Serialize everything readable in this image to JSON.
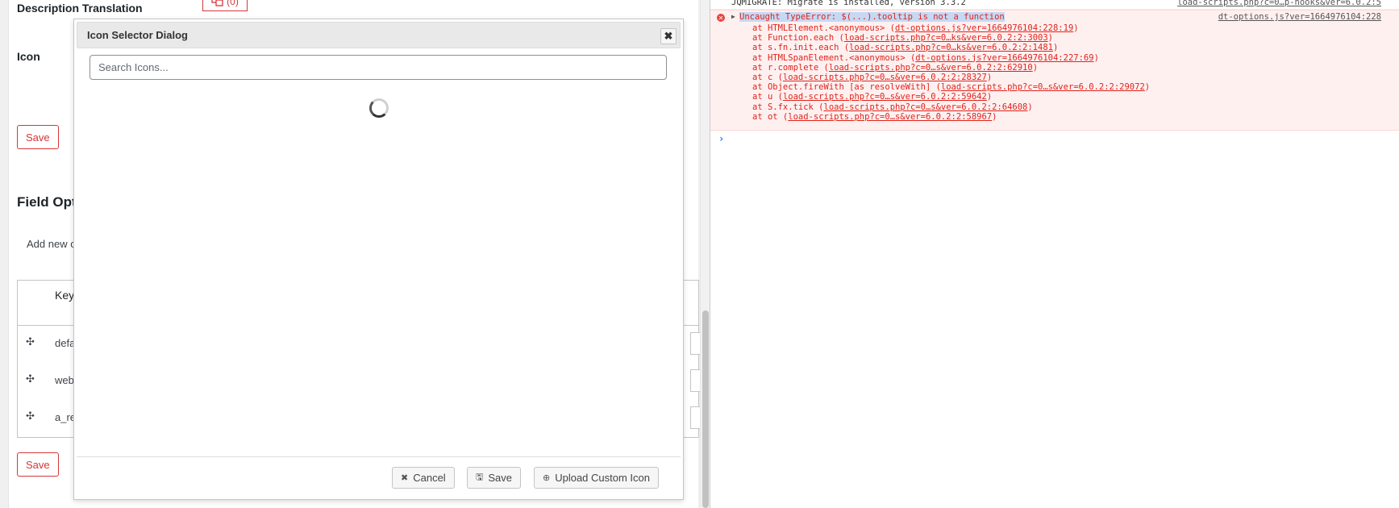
{
  "left_page": {
    "description_translation_label": "Description Translation",
    "translation_count": "(0)",
    "icon_label": "Icon",
    "save_top": "Save",
    "field_options_title": "Field Opt",
    "add_new_text": "Add new o",
    "table": {
      "header_key": "Key",
      "rows": [
        "defa",
        "web",
        "a_re"
      ]
    },
    "save_bottom": "Save"
  },
  "dialog": {
    "title": "Icon Selector Dialog",
    "close_glyph": "✖",
    "search_placeholder": "Search Icons...",
    "buttons": {
      "cancel": "Cancel",
      "save": "Save",
      "upload": "Upload Custom Icon"
    }
  },
  "console": {
    "info_line": "JQMIGRATE: Migrate is installed, version 3.3.2",
    "info_source": "load-scripts.php?c=0…p-hooks&ver=6.0.2:5",
    "error": {
      "title": "Uncaught TypeError: $(...).tooltip is not a function",
      "source": "dt-options.js?ver=1664976104:228",
      "stack": [
        {
          "fn": "at HTMLElement.<anonymous> (",
          "link": "dt-options.js?ver=1664976104:228:19",
          "end": ")"
        },
        {
          "fn": "at Function.each (",
          "link": "load-scripts.php?c=0…ks&ver=6.0.2:2:3003",
          "end": ")"
        },
        {
          "fn": "at s.fn.init.each (",
          "link": "load-scripts.php?c=0…ks&ver=6.0.2:2:1481",
          "end": ")"
        },
        {
          "fn": "at HTMLSpanElement.<anonymous> (",
          "link": "dt-options.js?ver=1664976104:227:69",
          "end": ")"
        },
        {
          "fn": "at r.complete (",
          "link": "load-scripts.php?c=0…s&ver=6.0.2:2:62910",
          "end": ")"
        },
        {
          "fn": "at c (",
          "link": "load-scripts.php?c=0…s&ver=6.0.2:2:28327",
          "end": ")"
        },
        {
          "fn": "at Object.fireWith [as resolveWith] (",
          "link": "load-scripts.php?c=0…s&ver=6.0.2:2:29072",
          "end": ")"
        },
        {
          "fn": "at u (",
          "link": "load-scripts.php?c=0…s&ver=6.0.2:2:59642",
          "end": ")"
        },
        {
          "fn": "at S.fx.tick (",
          "link": "load-scripts.php?c=0…s&ver=6.0.2:2:64608",
          "end": ")"
        },
        {
          "fn": "at ot (",
          "link": "load-scripts.php?c=0…s&ver=6.0.2:2:58967",
          "end": ")"
        }
      ]
    },
    "prompt_glyph": "›"
  }
}
